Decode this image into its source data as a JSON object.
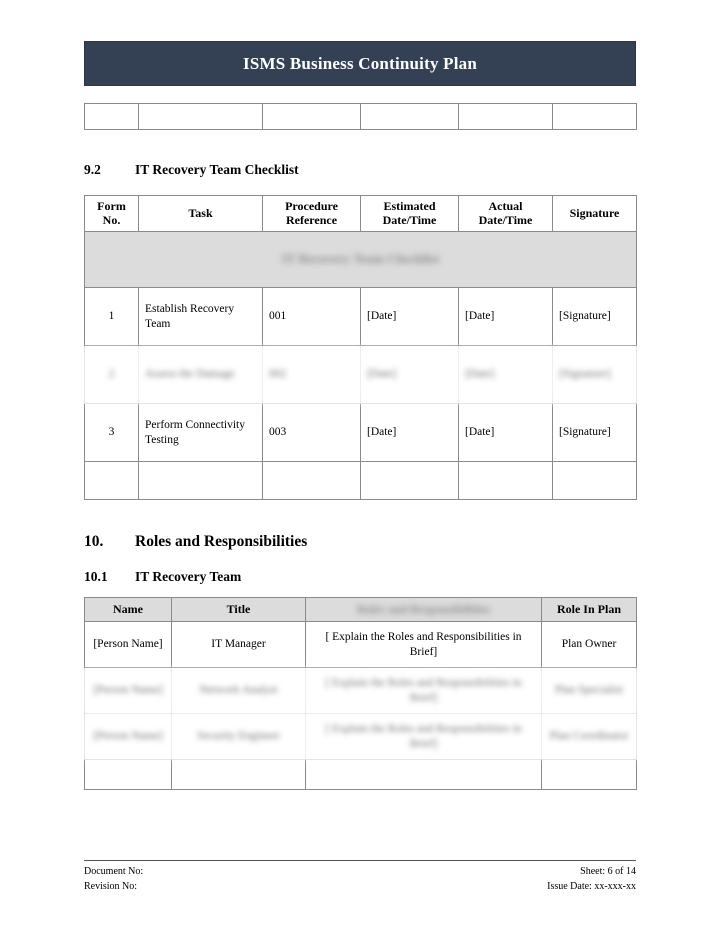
{
  "document": {
    "header_title": "ISMS Business Continuity Plan"
  },
  "blank_strip": {
    "cells": [
      "",
      "",
      "",
      "",
      "",
      ""
    ]
  },
  "sections": {
    "checklist": {
      "number": "9.2",
      "heading": "IT Recovery Team Checklist"
    },
    "roles": {
      "number": "10.",
      "heading": "Roles and Responsibilities"
    },
    "roles_sub": {
      "number": "10.1",
      "heading": "IT Recovery Team"
    }
  },
  "checklist_table": {
    "merged_title": "IT Recovery Team Checklist",
    "columns": [
      "Form No.",
      "Task",
      "Procedure Reference",
      "Estimated Date/Time",
      "Actual Date/Time",
      "Signature"
    ],
    "column_lines": {
      "form_l1": "Form",
      "form_l2": "No.",
      "task": "Task",
      "proc_l1": "Procedure",
      "proc_l2": "Reference",
      "est_l1": "Estimated",
      "est_l2": "Date/Time",
      "act_l1": "Actual",
      "act_l2": "Date/Time",
      "sig": "Signature"
    },
    "rows": [
      {
        "form_no": "1",
        "task": "Establish Recovery Team",
        "procedure_reference": "001",
        "estimated": "[Date]",
        "actual": "[Date]",
        "signature": "[Signature]",
        "blurred": false
      },
      {
        "form_no": "2",
        "task": "Assess the Damage",
        "procedure_reference": "002",
        "estimated": "[Date]",
        "actual": "[Date]",
        "signature": "[Signature]",
        "blurred": true
      },
      {
        "form_no": "3",
        "task": "Perform Connectivity Testing",
        "procedure_reference": "003",
        "estimated": "[Date]",
        "actual": "[Date]",
        "signature": "[Signature]",
        "blurred": false
      },
      {
        "form_no": "",
        "task": "",
        "procedure_reference": "",
        "estimated": "",
        "actual": "",
        "signature": "",
        "blurred": false
      }
    ]
  },
  "roles_table": {
    "columns": [
      "Name",
      "Title",
      "Roles and Responsibilities",
      "Role In Plan"
    ],
    "rows": [
      {
        "name": "[Person Name]",
        "title": "IT Manager",
        "responsibilities": "[ Explain the Roles and Responsibilities in Brief]",
        "role_in_plan": "Plan Owner",
        "blurred": false
      },
      {
        "name": "[Person Name]",
        "title": "Network Analyst",
        "responsibilities": "[ Explain the Roles and Responsibilities in Brief]",
        "role_in_plan": "Plan Specialist",
        "blurred": true
      },
      {
        "name": "[Person Name]",
        "title": "Security Engineer",
        "responsibilities": "[ Explain the Roles and Responsibilities in Brief]",
        "role_in_plan": "Plan Coordinator",
        "blurred": true
      },
      {
        "name": "",
        "title": "",
        "responsibilities": "",
        "role_in_plan": "",
        "blurred": false
      }
    ]
  },
  "footer": {
    "document_no": "Document No:",
    "revision_no": "Revision No:",
    "sheet": "Sheet: 6 of 14",
    "issue_date": "Issue Date: xx-xxx-xx"
  },
  "colors": {
    "banner": "#344154",
    "table_header_fill": "#dcdcdc",
    "border": "#8a8a8a"
  }
}
